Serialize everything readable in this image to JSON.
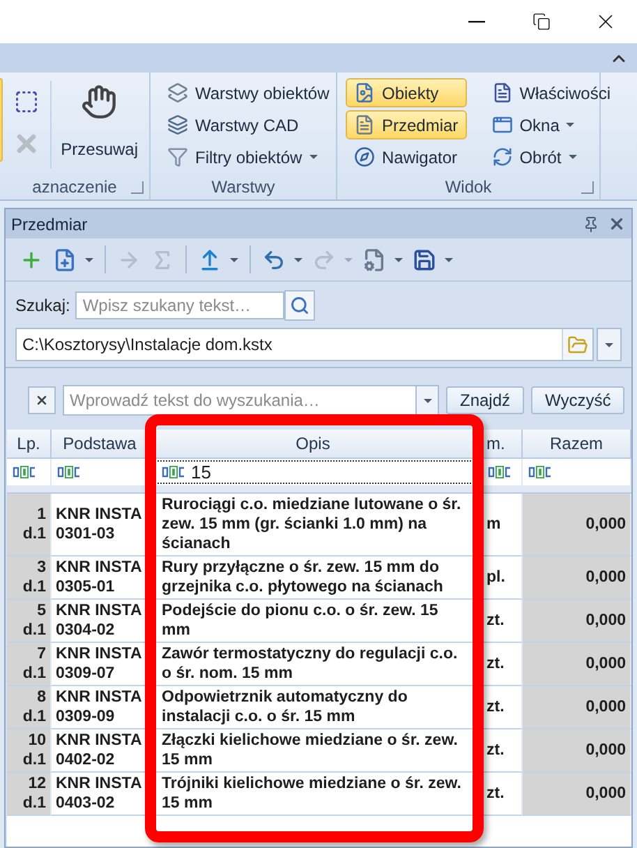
{
  "ribbon": {
    "groups": [
      {
        "label": "aznaczenie",
        "launcher": true,
        "items": [
          {
            "kind": "edge",
            "selected": true
          },
          {
            "kind": "icon",
            "disabled": false
          },
          {
            "kind": "icon",
            "disabled": true
          },
          {
            "kind": "large",
            "label": "Przesuwaj"
          }
        ]
      },
      {
        "label": "Warstwy",
        "launcher": false,
        "items": [
          {
            "kind": "small",
            "label": "Warstwy obiektów",
            "dropdown": false,
            "selected": false
          },
          {
            "kind": "small",
            "label": "Warstwy CAD",
            "dropdown": false,
            "selected": false
          },
          {
            "kind": "small",
            "label": "Filtry obiektów",
            "dropdown": true,
            "selected": false
          }
        ]
      },
      {
        "label": "Widok",
        "launcher": true,
        "items": [
          {
            "kind": "small",
            "label": "Obiekty",
            "dropdown": false,
            "selected": true
          },
          {
            "kind": "small",
            "label": "Przedmiar",
            "dropdown": false,
            "selected": true
          },
          {
            "kind": "small",
            "label": "Nawigator",
            "dropdown": false,
            "selected": false
          },
          {
            "kind": "break"
          },
          {
            "kind": "small",
            "label": "Właściwości",
            "dropdown": false,
            "selected": false
          },
          {
            "kind": "small",
            "label": "Okna",
            "dropdown": true,
            "selected": false
          },
          {
            "kind": "small",
            "label": "Obrót",
            "dropdown": true,
            "selected": false
          }
        ]
      }
    ]
  },
  "panel": {
    "title": "Przedmiar",
    "toolbar": [
      {
        "kind": "button",
        "disabled": false,
        "dropdown": false
      },
      {
        "kind": "button",
        "disabled": false,
        "dropdown": true
      },
      {
        "kind": "separator"
      },
      {
        "kind": "button",
        "disabled": true,
        "dropdown": false
      },
      {
        "kind": "button",
        "disabled": true,
        "dropdown": false
      },
      {
        "kind": "separator"
      },
      {
        "kind": "button",
        "disabled": false,
        "dropdown": true
      },
      {
        "kind": "separator"
      },
      {
        "kind": "button",
        "disabled": false,
        "dropdown": true
      },
      {
        "kind": "button",
        "disabled": true,
        "dropdown": true
      },
      {
        "kind": "button",
        "disabled": false,
        "dropdown": true
      },
      {
        "kind": "button",
        "disabled": false,
        "dropdown": true
      }
    ],
    "search": {
      "label": "Szukaj:",
      "placeholder": "Wpisz szukany tekst…"
    },
    "path": {
      "value": "C:\\Kosztorysy\\Instalacje dom.kstx"
    },
    "find": {
      "placeholder": "Wprowadź tekst do wyszukania…",
      "buttons": [
        "Znajdź",
        "Wyczyść"
      ]
    },
    "grid": {
      "columns": [
        {
          "label": "Lp."
        },
        {
          "label": "Podstawa"
        },
        {
          "label": "Opis",
          "filter_value": "15"
        },
        {
          "label": "m."
        },
        {
          "label": "Razem"
        }
      ],
      "rows": [
        {
          "lp": "1",
          "sub": "d.1",
          "basis": "KNR INSTA",
          "code": "0301-03",
          "description": "Rurociągi c.o. miedziane lutowane o śr. zew. 15 mm (gr. ścianki 1.0 mm) na ścianach",
          "unit": "m",
          "total": "0,000"
        },
        {
          "lp": "3",
          "sub": "d.1",
          "basis": "KNR INSTA",
          "code": "0305-01",
          "description": "Rury przyłączne o śr. zew. 15 mm do grzejnika c.o. płytowego na ścianach",
          "unit": "pl.",
          "total": "0,000"
        },
        {
          "lp": "5",
          "sub": "d.1",
          "basis": "KNR INSTA",
          "code": "0304-02",
          "description": "Podejście do pionu c.o. o śr. zew. 15 mm",
          "unit": "zt.",
          "total": "0,000"
        },
        {
          "lp": "7",
          "sub": "d.1",
          "basis": "KNR INSTA",
          "code": "0309-07",
          "description": "Zawór termostatyczny do regulacji c.o. o śr. nom. 15 mm",
          "unit": "zt.",
          "total": "0,000"
        },
        {
          "lp": "8",
          "sub": "d.1",
          "basis": "KNR INSTA",
          "code": "0309-09",
          "description": "Odpowietrznik automatyczny do instalacji c.o. o śr. 15 mm",
          "unit": "zt.",
          "total": "0,000"
        },
        {
          "lp": "10",
          "sub": "d.1",
          "basis": "KNR INSTA",
          "code": "0402-02",
          "description": "Złączki kielichowe miedziane o śr. zew. 15 mm",
          "unit": "zt.",
          "total": "0,000"
        },
        {
          "lp": "12",
          "sub": "d.1",
          "basis": "KNR INSTA",
          "code": "0403-02",
          "description": "Trójniki kielichowe miedziane o śr. zew. 15 mm",
          "unit": "zt.",
          "total": "0,000"
        }
      ]
    }
  }
}
